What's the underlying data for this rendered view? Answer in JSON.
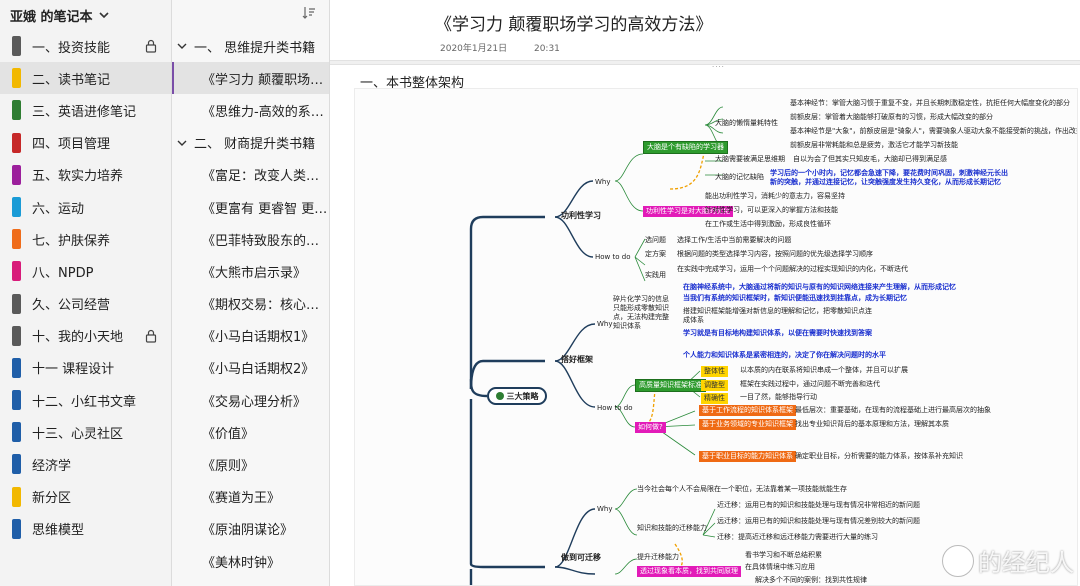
{
  "notebook": {
    "title": "亚娥 的笔记本"
  },
  "sections": [
    {
      "label": "一、投资技能",
      "color": "#5a5a5a",
      "locked": true
    },
    {
      "label": "二、读书笔记",
      "color": "#f2b800",
      "locked": false,
      "active": true
    },
    {
      "label": "三、英语进修笔记",
      "color": "#2e7d32",
      "locked": false
    },
    {
      "label": "四、项目管理",
      "color": "#c62828",
      "locked": false
    },
    {
      "label": "五、软实力培养",
      "color": "#9c1f9c",
      "locked": false
    },
    {
      "label": "六、运动",
      "color": "#1a9bd6",
      "locked": false
    },
    {
      "label": "七、护肤保养",
      "color": "#ef6c1a",
      "locked": false
    },
    {
      "label": "八、NPDP",
      "color": "#d81b7a",
      "locked": false
    },
    {
      "label": "久、公司经营",
      "color": "#5a5a5a",
      "locked": false
    },
    {
      "label": "十、我的小天地",
      "color": "#5a5a5a",
      "locked": true
    },
    {
      "label": "十一 课程设计",
      "color": "#1f5ea8",
      "locked": false
    },
    {
      "label": "十二、小红书文章",
      "color": "#1f5ea8",
      "locked": false
    },
    {
      "label": "十三、心灵社区",
      "color": "#1f5ea8",
      "locked": false
    },
    {
      "label": "经济学",
      "color": "#1f5ea8",
      "locked": false
    },
    {
      "label": "新分区",
      "color": "#f2b800",
      "locked": false
    },
    {
      "label": "思维模型",
      "color": "#1f5ea8",
      "locked": false
    }
  ],
  "pages": [
    {
      "label": "一、 思维提升类书籍",
      "type": "group"
    },
    {
      "label": "《学习力 颠覆职场学...",
      "type": "sub",
      "active": true
    },
    {
      "label": "《思维力-高效的系统...",
      "type": "sub"
    },
    {
      "label": "二、 财商提升类书籍",
      "type": "group"
    },
    {
      "label": "《富足：改变人类未...",
      "type": "sub"
    },
    {
      "label": "《更富有 更睿智 更快...",
      "type": "sub"
    },
    {
      "label": "《巴菲特致股东的信》",
      "type": "sub"
    },
    {
      "label": "《大熊市启示录》",
      "type": "sub"
    },
    {
      "label": "《期权交易：核心策...",
      "type": "sub"
    },
    {
      "label": "《小马白话期权1》",
      "type": "sub"
    },
    {
      "label": "《小马白话期权2》",
      "type": "sub"
    },
    {
      "label": "《交易心理分析》",
      "type": "sub"
    },
    {
      "label": "《价值》",
      "type": "sub"
    },
    {
      "label": "《原则》",
      "type": "sub"
    },
    {
      "label": "《赛道为王》",
      "type": "sub"
    },
    {
      "label": "《原油阴谋论》",
      "type": "sub"
    },
    {
      "label": "《美林时钟》",
      "type": "sub"
    }
  ],
  "page": {
    "title": "《学习力 颠覆职场学习的高效方法》",
    "date": "2020年1月21日",
    "time": "20:31",
    "grip": "....",
    "heading": "一、本书整体架构"
  },
  "mindmap": {
    "root": "三大策略",
    "branch1": "功利性学习",
    "branch2": "搭好框架",
    "branch3": "做到可迁移",
    "why": "Why",
    "how": "How to do",
    "n_big_brain": "大脑是个有缺陷的学习器",
    "n_useful": "功利性学习是对大脑的优化",
    "n_brain_energy": "大脑的懒惰量耗特性",
    "n_brain_memory": "大脑的记忆缺陷",
    "n_brain_time": "大脑需要被满足思维期",
    "n_e1": "基本神经节：掌管大脑习惯于重复不变，并且长期刺激稳定性，抗拒任何大幅度变化的部分",
    "n_e2": "前额皮层：掌管着大脑能够打破原有的习惯，形成大幅改变的部分",
    "n_e3": "基本神经节是\"大象\"，前额皮层是\"骑象人\"，需要骑象人驱动大象不能接受新的挑战，作出改变。",
    "n_e4": "前额皮层非常耗能和总是疲劳，激活它才能学习新技能",
    "n_m1": "学习后的一个小时内，记忆都会急速下降，要花费时间巩固，刺激神经元长出新的突触，并通过连接记忆，让突触强度发生持久变化，从而形成长期记忆",
    "n_t1": "自以为会了但其实只知皮毛，大脑却已得到满足感",
    "n_u1": "能出功利性学习，消耗少的意志力，容易坚持",
    "n_u2": "针对性学习，可以更深入的掌握方法和技能",
    "n_u3": "在工作或生活中得到激励，形成良性循环",
    "n_h1": "选问题",
    "n_h1t": "选择工作/生活中当前需要解决的问题",
    "n_h2": "定方案",
    "n_h2t": "根据问题的类型选择学习内容，按照问题的优先级选择学习顺序",
    "n_h3": "实践用",
    "n_h3t": "在实践中完成学习，运用一个个问题解决的过程实现知识的内化，不断迭代",
    "n_f_why": "碎片化学习的信息只能形成零散知识点，无法构建完整知识体系",
    "n_f_b1": "在脑神经系统中，大脑通过将新的知识与原有的知识网络连接来产生理解，从而形成记忆",
    "n_f_b2": "当我们有系统的知识框架时，新知识便能迅速找到挂靠点，成为长期记忆",
    "n_f_b3": "搭建知识框架能增强对新信息的理解和记忆，把零散知识点连成体系",
    "n_f_c1": "学习就是有目标地构建知识体系，以便在需要时快速找到答案",
    "n_f_c2": "个人能力和知识体系是紧密相连的，决定了你在解决问题时的水平",
    "n_fh_1": "高质量知识框架标准",
    "n_fh_1a": "整体性",
    "n_fh_1b": "调整型",
    "n_fh_1c": "精确性",
    "n_fh_1at": "以本质的内在联系将知识串成一个整体，并且可以扩展",
    "n_fh_1bt": "框架在实践过程中，通过问题不断完善和迭代",
    "n_fh_1ct": "一目了然，能够指导行动",
    "n_fh_2": "如何做?",
    "n_fh_2a": "基于工作流程的知识体系框架",
    "n_fh_2b": "基于业务领域的专业知识框架",
    "n_fh_2c": "基于职业目标的能力知识体系",
    "n_fh_2at": "最低层次：重要基础，在现有的流程基础上进行最高层次的抽象",
    "n_fh_2bt": "找出专业知识背后的基本原理和方法，理解其本质",
    "n_fh_2ct": "确定职业目标，分析需要的能力体系，按体系补充知识",
    "n_t_why": "当今社会每个人不会局限在一个职位，无法靠着某一项技能就能生存",
    "n_t_a": "知识和技能的迁移能力",
    "n_t_a1": "近迁移：运用已有的知识和技能处理与现有情况非常相近的新问题",
    "n_t_a2": "远迁移：运用已有的知识和技能处理与现有情况差别较大的新问题",
    "n_t_a3": "迁移：提高近迁移和远迁移能力需要进行大量的练习",
    "n_t_how": "提升迁移能力",
    "n_t_h1": "看书学习和不断总结积累",
    "n_t_h2": "在具体情境中练习应用",
    "n_t_g": "透过现象看本质，找到共同原理",
    "n_t_y": "解决多个不同的案例：找到共性规律"
  },
  "watermark": "的经纪人",
  "colors": {
    "active_page_bar": "#7a4ea8",
    "root_border": "#1f3d5c"
  }
}
